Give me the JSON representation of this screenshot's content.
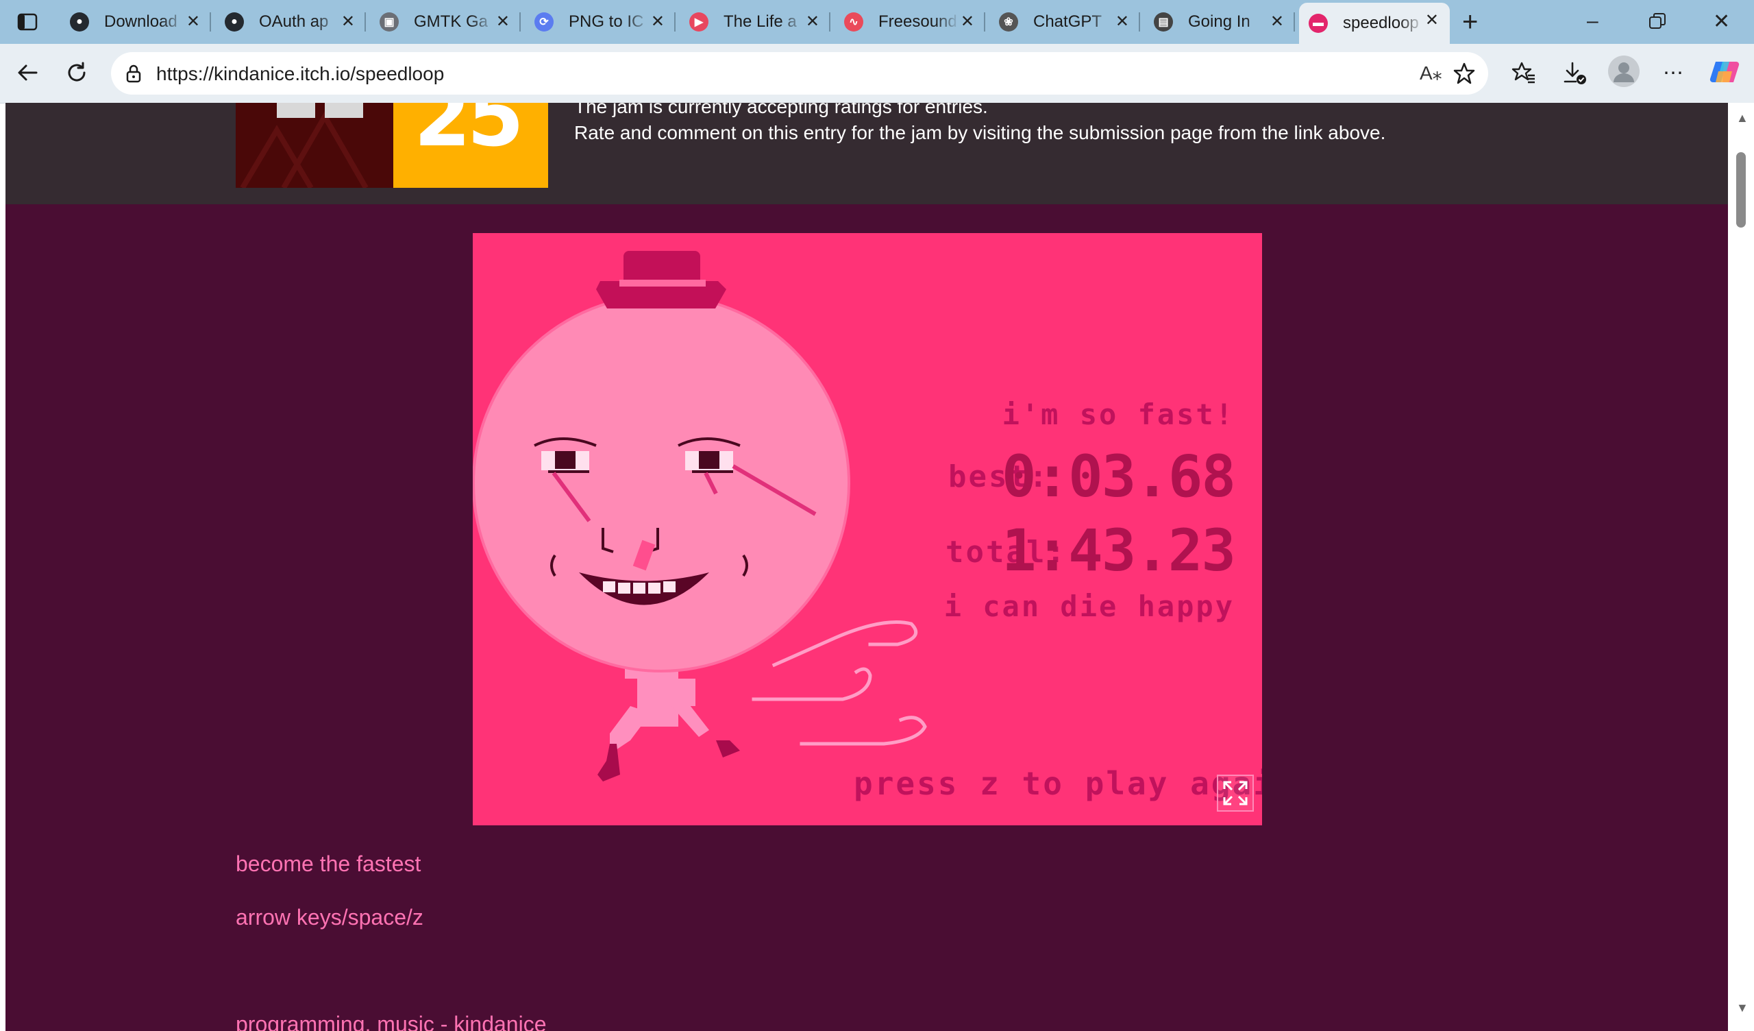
{
  "browser": {
    "tabs": [
      {
        "title": "Download",
        "icon": "github-icon",
        "color": "#24292f"
      },
      {
        "title": "OAuth ap",
        "icon": "github-icon",
        "color": "#24292f"
      },
      {
        "title": "GMTK Ga",
        "icon": "itch-icon",
        "color": "#6b6f76"
      },
      {
        "title": "PNG to IC",
        "icon": "convert-icon",
        "color": "#5b7cf0"
      },
      {
        "title": "The Life a",
        "icon": "youtube-icon",
        "color": "#e8475f"
      },
      {
        "title": "Freesound",
        "icon": "freesound-icon",
        "color": "#ea4a5a"
      },
      {
        "title": "ChatGPT",
        "icon": "chatgpt-icon",
        "color": "#555555"
      },
      {
        "title": "Going In",
        "icon": "jam-icon",
        "color": "#444444"
      },
      {
        "title": "speedloop",
        "icon": "speedloop-icon",
        "color": "#e3256b"
      }
    ],
    "active_tab_index": 8,
    "url": "https://kindanice.itch.io/speedloop"
  },
  "jam": {
    "line1": "The jam is currently accepting ratings for entries.",
    "line2": "Rate and comment on this entry for the jam by visiting the submission page from the link above.",
    "thumb_number": "25"
  },
  "game": {
    "message_top": "i'm so fast!",
    "best_label": "best:",
    "best_value": "0:03.68",
    "total_label": "total:",
    "total_value": "1:43.23",
    "message_bottom": "i can die happy",
    "prompt": "press z to play again"
  },
  "description": {
    "line1": "become the fastest",
    "line2": "arrow keys/space/z",
    "line3": "programming, music - kindanice"
  },
  "colors": {
    "page_bg": "#4a0d33",
    "banner_bg": "#352b31",
    "game_bg": "#ff3377",
    "link": "#ff73b3"
  }
}
